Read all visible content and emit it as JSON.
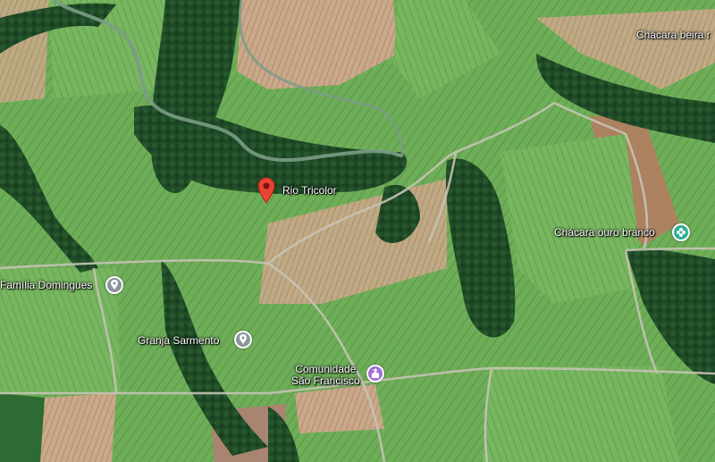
{
  "places": {
    "rio": "Rio Tricolor",
    "chacara_beira": "Chácara beira r",
    "chacara_ouro": "Chácara ouro branco",
    "familia": "Família Domingues",
    "granja": "Granja Sarmento",
    "comunidade_line1": "Comunidade",
    "comunidade_line2": "São Francisco"
  },
  "icons": {
    "rio": "red-location-pin",
    "chacara_ouro": "flower-icon",
    "familia": "location-circle-icon",
    "granja": "location-circle-icon",
    "comunidade": "church-icon"
  },
  "colors": {
    "pin_red": "#ea4335",
    "poi_grey": "#8a949c",
    "poi_purple": "#a46fd6",
    "poi_teal": "#2fae94"
  }
}
